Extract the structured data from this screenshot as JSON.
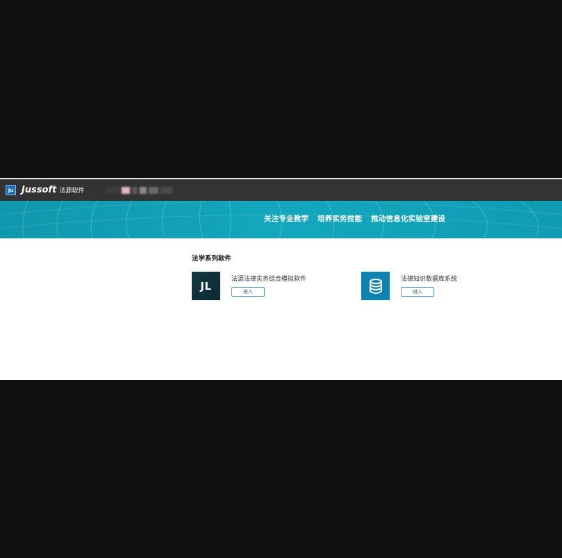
{
  "header": {
    "logo_text": "Ju",
    "brand_name": "Jussoft",
    "brand_sub": "法源软件"
  },
  "banner": {
    "slogans": [
      "关注专业教学",
      "培养实务技能",
      "推动信息化实验室建设"
    ]
  },
  "section": {
    "title": "法学系列软件"
  },
  "products": [
    {
      "icon_text": "JL",
      "icon": "jl-logo-icon",
      "name": "法源法律实务综合模拟软件",
      "button_label": "进入"
    },
    {
      "icon": "database-icon",
      "name": "法律知识数据库系统",
      "button_label": "进入"
    }
  ],
  "colors": {
    "topbar": "#333333",
    "banner": "#13a7bd",
    "jl_icon": "#0b2a32",
    "db_icon": "#0e83b0",
    "button_border": "#4d9fcf"
  }
}
